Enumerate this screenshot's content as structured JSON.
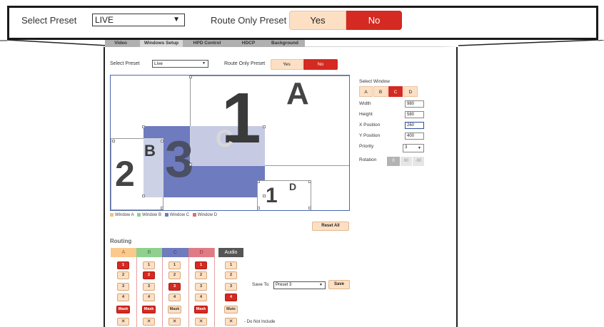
{
  "zoom": {
    "preset_label": "Select Preset",
    "preset_value": "LIVE",
    "route_only_label": "Route Only Preset",
    "yes_label": "Yes",
    "no_label": "No"
  },
  "tabs": [
    "Video",
    "Windows Setup",
    "HPD Control",
    "HDCP",
    "Background"
  ],
  "active_tab": "Windows Setup",
  "settings": {
    "preset_label": "Select Preset",
    "preset_value": "Live",
    "route_only_label": "Route Only Preset",
    "yes_label": "Yes",
    "no_label": "No"
  },
  "canvas": {
    "win_a_letter": "A",
    "win_a_num": "1",
    "win_b_letter": "B",
    "win_b_num": "2",
    "win_c_letter": "C",
    "win_c_num": "3",
    "win_d_letter": "D",
    "win_d_num": "1"
  },
  "legend": [
    "Window A",
    "Window B",
    "Window C",
    "Window D"
  ],
  "colors": {
    "accent": "#d42a21",
    "button_bg": "#fde0c4",
    "window_a": "#f0c27b",
    "window_b": "#8fd08f",
    "window_c": "#6e7bbf",
    "window_d": "#d9707a"
  },
  "reset_all_label": "Reset All",
  "select_window": {
    "title": "Select Window",
    "options": [
      "A",
      "B",
      "C",
      "D"
    ],
    "selected": "C",
    "width_label": "Width",
    "width_value": "980",
    "height_label": "Height",
    "height_value": "580",
    "xpos_label": "X Position",
    "xpos_value": "260",
    "ypos_label": "Y Position",
    "ypos_value": "400",
    "priority_label": "Priority",
    "priority_value": "3",
    "rotation_label": "Rotation",
    "rotation_options": [
      "0",
      "90",
      "-90"
    ],
    "rotation_selected": "0"
  },
  "routing": {
    "title": "Routing",
    "columns": [
      "A",
      "B",
      "C",
      "D"
    ],
    "audio_label": "Audio",
    "inputs": [
      "1",
      "2",
      "3",
      "4"
    ],
    "mask_label": "Mask",
    "mute_label": "Mute",
    "x_label": "✕",
    "selected": {
      "A": "1",
      "B": "2",
      "C": "3",
      "D": "1",
      "Audio": "4"
    },
    "mask_selected": {
      "A": true,
      "B": true,
      "C": false,
      "D": true
    },
    "save_to_label": "Save To",
    "save_to_value": "Preset 3",
    "save_label": "Save",
    "do_not_include_label": "- Do Not Include"
  }
}
